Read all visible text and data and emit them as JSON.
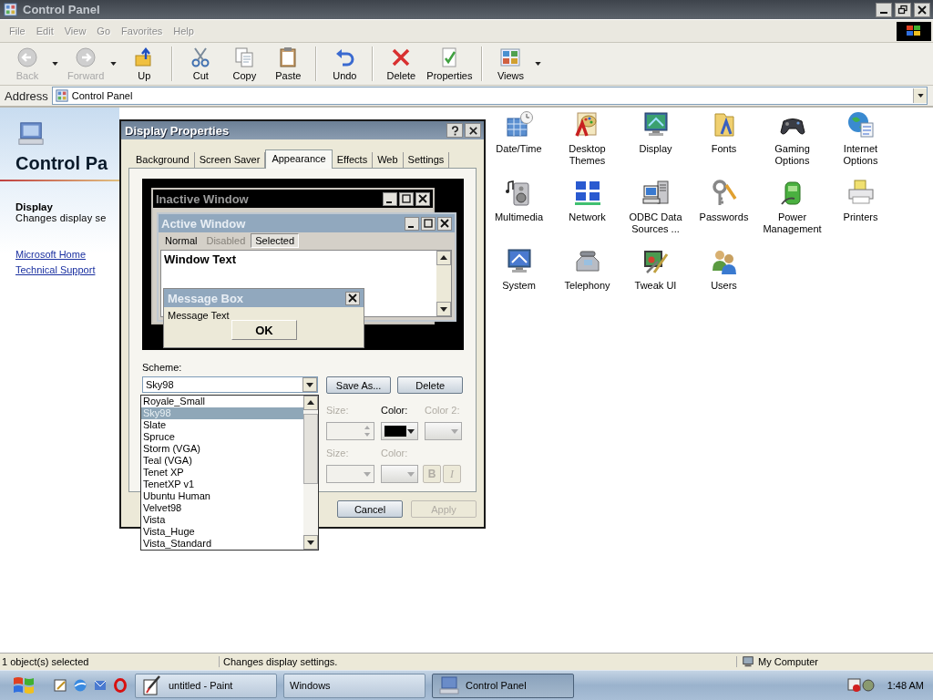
{
  "window": {
    "title": "Control Panel"
  },
  "menu": [
    "File",
    "Edit",
    "View",
    "Go",
    "Favorites",
    "Help"
  ],
  "toolbar": {
    "groups": [
      {
        "buttons": [
          {
            "kind": "back",
            "label": "Back",
            "disabled": true,
            "dropdown": true
          },
          {
            "kind": "forward",
            "label": "Forward",
            "disabled": true,
            "dropdown": true
          },
          {
            "kind": "up",
            "label": "Up",
            "disabled": false,
            "dropdown": false
          }
        ]
      },
      {
        "buttons": [
          {
            "kind": "cut",
            "label": "Cut",
            "disabled": false,
            "dropdown": false
          },
          {
            "kind": "copy",
            "label": "Copy",
            "disabled": false,
            "dropdown": false
          },
          {
            "kind": "paste",
            "label": "Paste",
            "disabled": false,
            "dropdown": false
          }
        ]
      },
      {
        "buttons": [
          {
            "kind": "undo",
            "label": "Undo",
            "disabled": false,
            "dropdown": false
          }
        ]
      },
      {
        "buttons": [
          {
            "kind": "delete",
            "label": "Delete",
            "disabled": false,
            "dropdown": false
          },
          {
            "kind": "properties",
            "label": "Properties",
            "disabled": false,
            "dropdown": false
          }
        ]
      },
      {
        "buttons": [
          {
            "kind": "views",
            "label": "Views",
            "disabled": false,
            "dropdown": true
          }
        ]
      }
    ]
  },
  "address": {
    "label": "Address",
    "value": "Control Panel"
  },
  "side_panel": {
    "title": "Control Pa",
    "selection": {
      "name": "Display",
      "description": "Changes display se"
    },
    "links": [
      "Microsoft Home",
      "Technical Support"
    ]
  },
  "icons": [
    {
      "label": "Date/Time",
      "kind": "datetime"
    },
    {
      "label": "Desktop Themes",
      "kind": "themes"
    },
    {
      "label": "Display",
      "kind": "display"
    },
    {
      "label": "Fonts",
      "kind": "fonts"
    },
    {
      "label": "Gaming Options",
      "kind": "gaming"
    },
    {
      "label": "Internet Options",
      "kind": "internet"
    },
    {
      "label": "Multimedia",
      "kind": "multimedia"
    },
    {
      "label": "Network",
      "kind": "network"
    },
    {
      "label": "ODBC Data Sources ...",
      "kind": "odbc"
    },
    {
      "label": "Passwords",
      "kind": "passwords"
    },
    {
      "label": "Power Management",
      "kind": "power"
    },
    {
      "label": "Printers",
      "kind": "printers"
    },
    {
      "label": "System",
      "kind": "system"
    },
    {
      "label": "Telephony",
      "kind": "telephony"
    },
    {
      "label": "Tweak UI",
      "kind": "tweakui"
    },
    {
      "label": "Users",
      "kind": "users"
    }
  ],
  "dialog": {
    "title": "Display Properties",
    "tabs": [
      {
        "label": "Background",
        "selected": false
      },
      {
        "label": "Screen Saver",
        "selected": false
      },
      {
        "label": "Appearance",
        "selected": true
      },
      {
        "label": "Effects",
        "selected": false
      },
      {
        "label": "Web",
        "selected": false
      },
      {
        "label": "Settings",
        "selected": false
      }
    ],
    "preview": {
      "inactive_title": "Inactive Window",
      "active_title": "Active Window",
      "menu": [
        {
          "label": "Normal",
          "kind": "normal"
        },
        {
          "label": "Disabled",
          "kind": "disabled"
        },
        {
          "label": "Selected",
          "kind": "selected"
        }
      ],
      "window_text": "Window Text",
      "message_title": "Message Box",
      "message_text": "Message Text",
      "ok_label": "OK"
    },
    "scheme": {
      "label": "Scheme:",
      "value": "Sky98",
      "options": [
        {
          "label": "Royale_Small",
          "selected": false
        },
        {
          "label": "Sky98",
          "selected": true
        },
        {
          "label": "Slate",
          "selected": false
        },
        {
          "label": "Spruce",
          "selected": false
        },
        {
          "label": "Storm (VGA)",
          "selected": false
        },
        {
          "label": "Teal (VGA)",
          "selected": false
        },
        {
          "label": "Tenet XP",
          "selected": false
        },
        {
          "label": "TenetXP v1",
          "selected": false
        },
        {
          "label": "Ubuntu Human",
          "selected": false
        },
        {
          "label": "Velvet98",
          "selected": false
        },
        {
          "label": "Vista",
          "selected": false
        },
        {
          "label": "Vista_Huge",
          "selected": false
        },
        {
          "label": "Vista_Standard",
          "selected": false
        }
      ]
    },
    "scheme_buttons": [
      "Save As...",
      "Delete"
    ],
    "item_rows": [
      {
        "fields": [
          {
            "kind": "spinner",
            "label": "Size:",
            "disabled": true
          },
          {
            "kind": "color",
            "label": "Color:",
            "disabled": false,
            "color": "#000000"
          },
          {
            "kind": "color",
            "label": "Color 2:",
            "disabled": true
          }
        ]
      },
      {
        "fields": [
          {
            "kind": "select",
            "label": "Size:",
            "disabled": true
          },
          {
            "kind": "color",
            "label": "Color:",
            "disabled": true
          },
          {
            "kind": "bold",
            "label": "B",
            "disabled": true
          },
          {
            "kind": "italic",
            "label": "I",
            "disabled": true
          }
        ]
      }
    ],
    "footer_buttons": [
      {
        "label": "Cancel",
        "disabled": false
      },
      {
        "label": "Apply",
        "disabled": true
      }
    ]
  },
  "status_bar": {
    "selection": "1 object(s) selected",
    "description": "Changes display settings.",
    "zone": "My Computer"
  },
  "taskbar": {
    "tasks": [
      {
        "label": "untitled - Paint",
        "kind": "paint",
        "selected": false
      },
      {
        "label": "Windows",
        "kind": "plain",
        "selected": false
      },
      {
        "label": "Control Panel",
        "kind": "control_panel",
        "selected": true
      }
    ],
    "clock": "1:48 AM"
  }
}
